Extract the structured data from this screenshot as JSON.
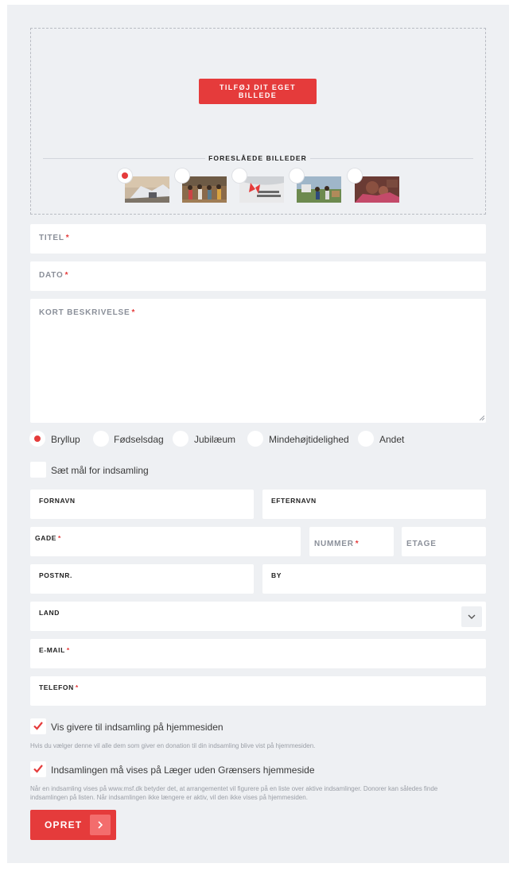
{
  "upload": {
    "button_label": "TILFØJ DIT EGET BILLEDE",
    "suggested_title": "FORESLÅEDE BILLEDER",
    "suggested_images": [
      {
        "icon": "photo-tent-camp",
        "selected": true
      },
      {
        "icon": "photo-crowd-walking",
        "selected": false
      },
      {
        "icon": "photo-msf-flag",
        "selected": false
      },
      {
        "icon": "photo-field-people",
        "selected": false
      },
      {
        "icon": "photo-mother-child",
        "selected": false
      }
    ]
  },
  "form": {
    "title_label": "TITEL",
    "date_label": "DATO",
    "description_label": "KORT BESKRIVELSE",
    "required_mark": "*"
  },
  "occasion": {
    "options": [
      "Bryllup",
      "Fødselsdag",
      "Jubilæum",
      "Mindehøjtidelighed",
      "Andet"
    ],
    "selected": "Bryllup"
  },
  "goal": {
    "label": "Sæt mål for indsamling",
    "checked": false
  },
  "address": {
    "firstname_label": "FORNAVN",
    "lastname_label": "EFTERNAVN",
    "street_label": "GADE",
    "number_label": "NUMMER",
    "floor_label": "ETAGE",
    "zip_label": "POSTNR.",
    "city_label": "BY",
    "country_label": "LAND",
    "email_label": "E-MAIL",
    "phone_label": "TELEFON"
  },
  "consents": {
    "show_donors_label": "Vis givere til indsamling på hjemmesiden",
    "show_donors_help": "Hvis du vælger denne vil alle dem som giver en donation til din indsamling blive vist på hjemmesiden.",
    "show_donors_checked": true,
    "show_on_site_label": "Indsamlingen må vises på Læger uden Grænsers hjemmeside",
    "show_on_site_help_1": "Når en indsamling vises på www.msf.dk betyder det, at arrangementet vil figurere på en liste over aktive indsamlinger. Donorer kan således finde",
    "show_on_site_help_2": "indsamlingen på listen. Når indsamlingen ikke længere er aktiv, vil den ikke vises på hjemmesiden.",
    "show_on_site_checked": true
  },
  "submit": {
    "label": "OPRET"
  },
  "colors": {
    "accent": "#e53b3b",
    "panel": "#eef0f3",
    "field": "#ffffff"
  }
}
